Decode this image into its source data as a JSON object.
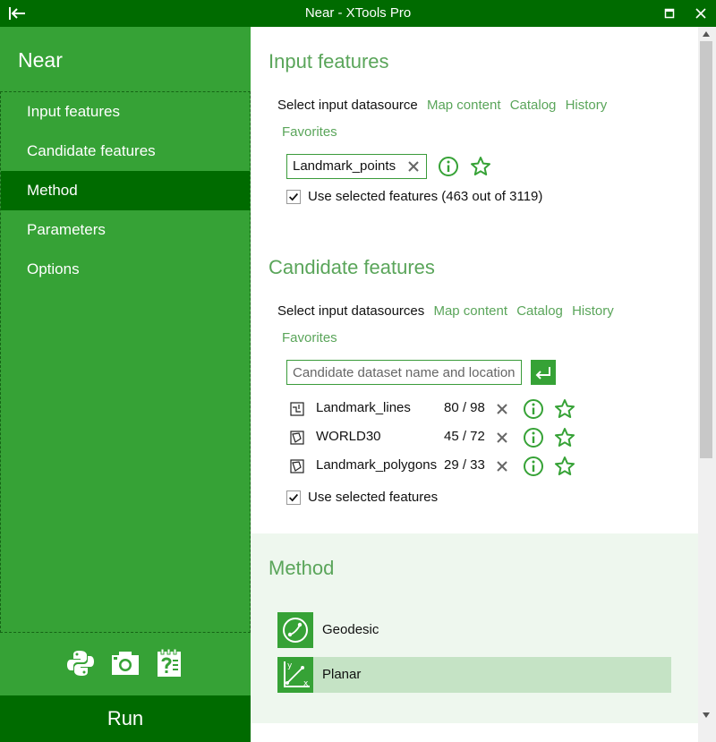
{
  "window": {
    "title": "Near - XTools Pro"
  },
  "sidebar": {
    "heading": "Near",
    "items": [
      {
        "label": "Input features",
        "active": false
      },
      {
        "label": "Candidate features",
        "active": false
      },
      {
        "label": "Method",
        "active": true
      },
      {
        "label": "Parameters",
        "active": false
      },
      {
        "label": "Options",
        "active": false
      }
    ],
    "tools": [
      "python-icon",
      "camera-icon",
      "help-docs-icon"
    ],
    "run_label": "Run"
  },
  "input_features": {
    "title": "Input features",
    "select_label": "Select input datasource",
    "links": [
      "Map content",
      "Catalog",
      "History",
      "Favorites"
    ],
    "dataset": "Landmark_points",
    "use_selected": "Use selected features (463 out of 3119)",
    "use_selected_checked": true
  },
  "candidate_features": {
    "title": "Candidate features",
    "select_label": "Select input datasources",
    "links": [
      "Map content",
      "Catalog",
      "History",
      "Favorites"
    ],
    "placeholder": "Candidate dataset name and location",
    "datasets": [
      {
        "type": "line-layer-icon",
        "name": "Landmark_lines",
        "count": "80 / 98"
      },
      {
        "type": "polygon-layer-icon",
        "name": "WORLD30",
        "count": "45 / 72"
      },
      {
        "type": "polygon-layer-icon",
        "name": "Landmark_polygons",
        "count": "29 / 33"
      }
    ],
    "use_selected": "Use selected features",
    "use_selected_checked": true
  },
  "method": {
    "title": "Method",
    "options": [
      {
        "label": "Geodesic",
        "icon": "geodesic-icon",
        "selected": false
      },
      {
        "label": "Planar",
        "icon": "planar-icon",
        "selected": true
      }
    ]
  },
  "colors": {
    "dark_green": "#006b00",
    "sidebar_green": "#36a236",
    "accent": "#5aa55a"
  }
}
